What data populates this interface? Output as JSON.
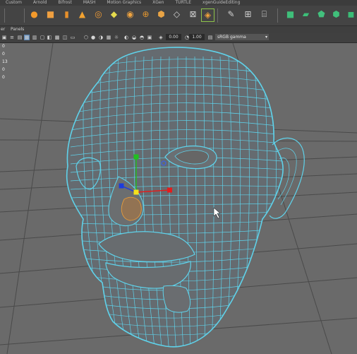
{
  "shelf_tabs": [
    "Custom",
    "Arnold",
    "Bifrost",
    "MASH",
    "Motion Graphics",
    "XGen",
    "TURTLE",
    "xgenGuideEditing"
  ],
  "panel_menu": {
    "view": "er",
    "panels": "Panels"
  },
  "viewport_toolbar": {
    "value_a": "0.00",
    "value_b": "1.00",
    "color_space": "sRGB gamma"
  },
  "hud_values": [
    "0",
    "0",
    "13",
    "0",
    "0",
    "0"
  ],
  "colors": {
    "wireframe": "#5fd2ea",
    "manipulator_x": "#e31d1d",
    "manipulator_y": "#20c020",
    "manipulator_z": "#1c3cdd",
    "manipulator_center": "#f5e21c",
    "shelf_bg": "#444444",
    "viewport_bg": "#6a6a6a"
  }
}
